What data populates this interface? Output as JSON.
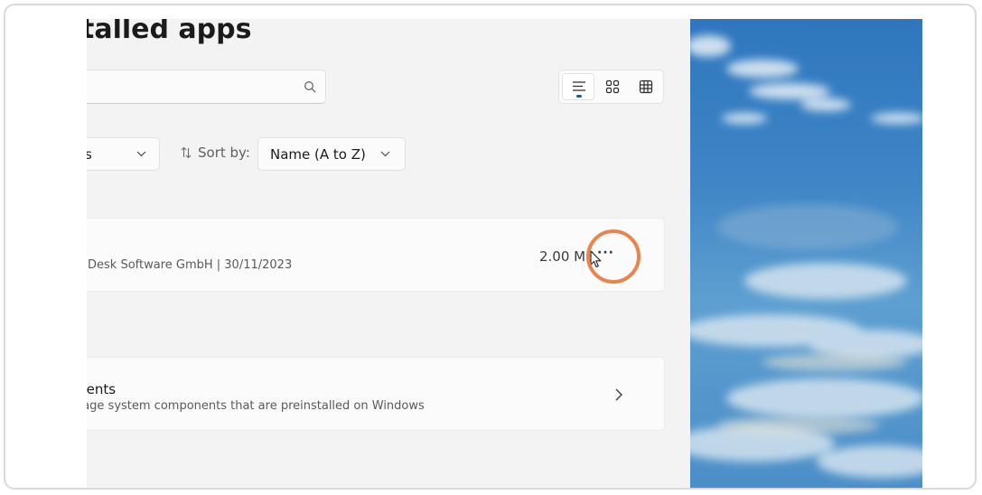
{
  "page": {
    "title": "talled apps"
  },
  "search": {
    "placeholder": "",
    "icon": "search-icon"
  },
  "view_modes": {
    "items": [
      {
        "name": "list-view",
        "icon": "list-icon",
        "selected": true
      },
      {
        "name": "grid-view",
        "icon": "grid-icon",
        "selected": false
      },
      {
        "name": "tile-view",
        "icon": "tile-icon",
        "selected": false
      }
    ]
  },
  "filters": {
    "filter_value": "s",
    "sort_label": "Sort by:",
    "sort_value": "Name (A to Z)"
  },
  "app": {
    "meta": "Desk Software GmbH  |  30/11/2023",
    "size": "2.00 MB"
  },
  "components": {
    "title": "onents",
    "subtitle": "anage system components that are preinstalled on Windows"
  },
  "colors": {
    "accent": "#0067c0",
    "highlight_ring": "#e8844c",
    "pane_background": "#f3f3f3"
  }
}
